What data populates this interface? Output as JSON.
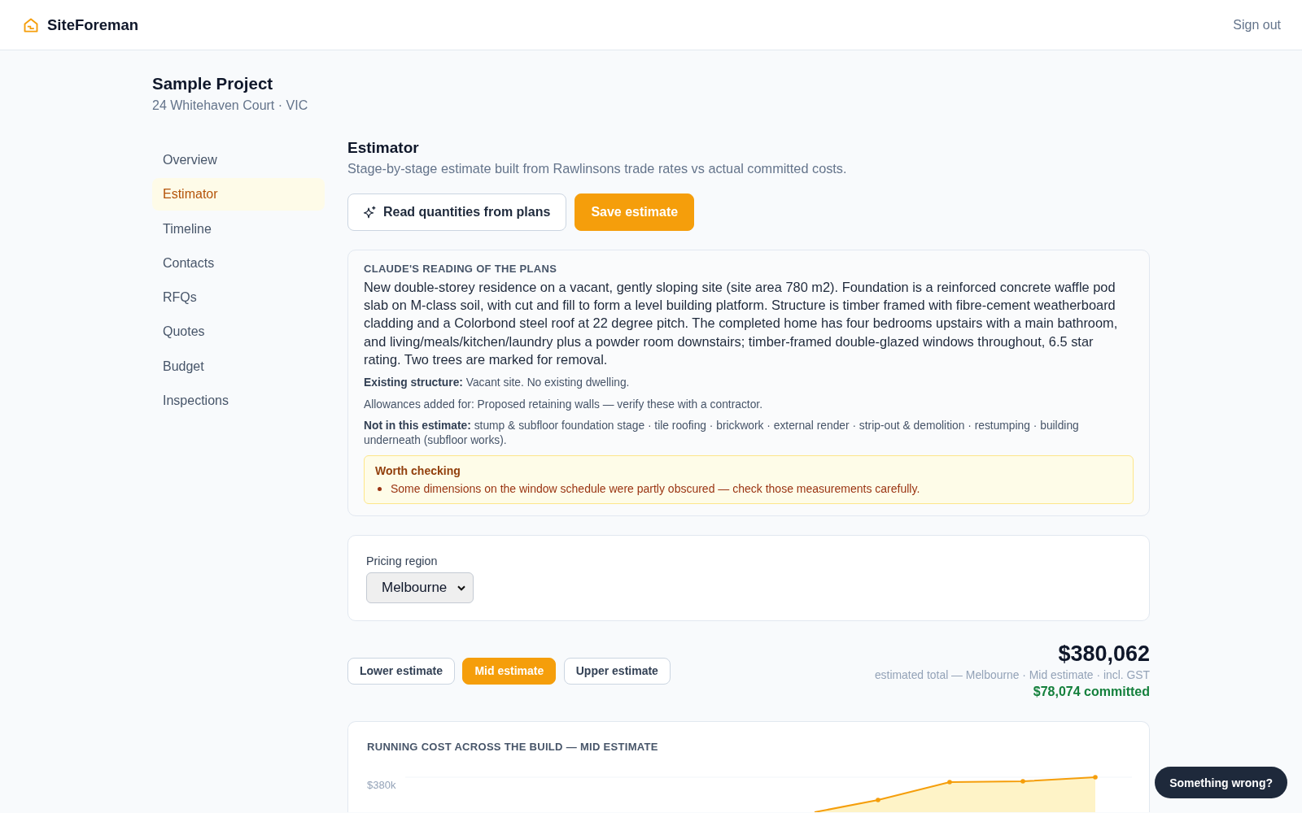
{
  "header": {
    "brand": "SiteForeman",
    "sign_out": "Sign out"
  },
  "project": {
    "title": "Sample Project",
    "address": "24 Whitehaven Court · VIC"
  },
  "sidebar": {
    "items": [
      {
        "label": "Overview",
        "selected": false
      },
      {
        "label": "Estimator",
        "selected": true
      },
      {
        "label": "Timeline",
        "selected": false
      },
      {
        "label": "Contacts",
        "selected": false
      },
      {
        "label": "RFQs",
        "selected": false
      },
      {
        "label": "Quotes",
        "selected": false
      },
      {
        "label": "Budget",
        "selected": false
      },
      {
        "label": "Inspections",
        "selected": false
      }
    ]
  },
  "estimator": {
    "title": "Estimator",
    "subtitle": "Stage-by-stage estimate built from Rawlinsons trade rates vs actual committed costs.",
    "actions": [
      {
        "label": "Read quantities from plans",
        "kind": "outline"
      },
      {
        "label": "Save estimate",
        "kind": "filled"
      }
    ]
  },
  "plans_reading": {
    "heading": "CLAUDE'S READING OF THE PLANS",
    "summary": "New double-storey residence on a vacant, gently sloping site (site area 780 m2). Foundation is a reinforced concrete waffle pod slab on M-class soil, with cut and fill to form a level building platform. Structure is timber framed with fibre-cement weatherboard cladding and a Colorbond steel roof at 22 degree pitch. The completed home has four bedrooms upstairs with a main bathroom, and living/meals/kitchen/laundry plus a powder room downstairs; timber-framed double-glazed windows throughout, 6.5 star rating. Two trees are marked for removal.",
    "notes": [
      "**Existing structure:** Vacant site. No existing dwelling.",
      "Allowances added for: Proposed retaining walls — verify these with a contractor.",
      "**Not in this estimate:** stump & subfloor foundation stage · tile roofing · brickwork · external render · strip-out & demolition · restumping · building underneath (subfloor works)."
    ],
    "warning": {
      "title": "Worth checking",
      "items": [
        "Some dimensions on the window schedule were partly obscured — check those measurements carefully."
      ]
    }
  },
  "pricing_region": {
    "label": "Pricing region",
    "value": "Melbourne"
  },
  "estimate_tabs": [
    {
      "label": "Lower estimate",
      "selected": false
    },
    {
      "label": "Mid estimate",
      "selected": true
    },
    {
      "label": "Upper estimate",
      "selected": false
    }
  ],
  "total": {
    "amount": "$380,062",
    "caption": "estimated total — Melbourne · Mid estimate · incl. GST",
    "committed": "$78,074 committed"
  },
  "chart": {
    "title": "RUNNING COST ACROSS THE BUILD — MID ESTIMATE",
    "axis_labels": [
      "$380k"
    ]
  },
  "feedback_button": "Something wrong?"
}
